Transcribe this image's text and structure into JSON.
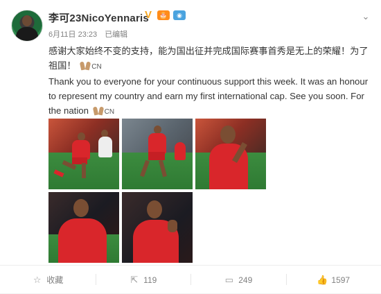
{
  "post": {
    "username": "李可23NicoYennaris",
    "verified_icon": "V",
    "badge_1": "🎂",
    "badge_2": "◉",
    "date": "6月11日 23:23",
    "edited": "已编辑",
    "text_cn": "感谢大家始终不变的支持，能为国出征并完成国际赛事首秀是无上的荣耀！为了祖国！",
    "text_cn_suffix": "CN",
    "text_en": "Thank you to everyone for your continuous support this week. It was an honour to represent my country and earn my first international cap. See you soon. For the nation",
    "text_en_suffix": "CN"
  },
  "photos": [
    {
      "name": "photo-1",
      "scene": "action-dribble"
    },
    {
      "name": "photo-2",
      "scene": "action-run"
    },
    {
      "name": "photo-3",
      "scene": "portrait-applause"
    },
    {
      "name": "photo-4",
      "scene": "portrait-back"
    },
    {
      "name": "photo-5",
      "scene": "portrait-clap"
    }
  ],
  "actions": {
    "favorite_label": "收藏",
    "repost_count": "119",
    "comment_count": "249",
    "like_count": "1597"
  },
  "icons": {
    "favorite": "star-icon",
    "repost": "share-icon",
    "comment": "comment-icon",
    "like": "thumbs-up-icon",
    "more": "chevron-down-icon"
  },
  "colors": {
    "accent_orange": "#f5a623",
    "jersey_red": "#d9262b",
    "text": "#333333",
    "muted": "#808080"
  }
}
